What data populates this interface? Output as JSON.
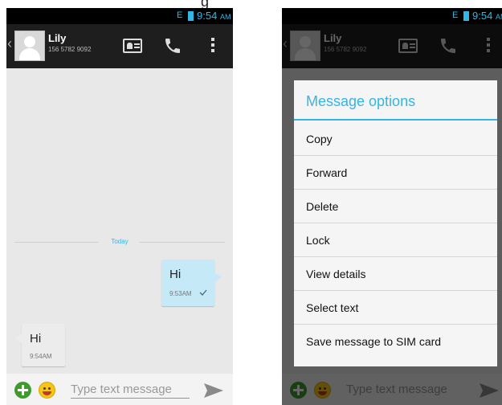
{
  "status": {
    "time": "9:54",
    "ampm": "AM",
    "network": "E"
  },
  "caption": "g",
  "contact": {
    "name": "Lily",
    "number": "156 5782 9092"
  },
  "thread": {
    "divider": "Today",
    "messages": [
      {
        "direction": "outgoing",
        "text": "Hi",
        "time": "9:53AM",
        "delivered": true
      },
      {
        "direction": "incoming",
        "text": "Hi",
        "time": "9:54AM"
      }
    ]
  },
  "composer": {
    "placeholder": "Type text message"
  },
  "dialog": {
    "title": "Message options",
    "options": [
      "Copy",
      "Forward",
      "Delete",
      "Lock",
      "View details",
      "Select text",
      "Save message to SIM card"
    ]
  },
  "colors": {
    "accent": "#33b5e5",
    "action_bar": "#1e1e1e",
    "outgoing_bubble": "#c6e9f7",
    "incoming_bubble": "#ececec",
    "add_button": "#3f9b2e"
  },
  "icons": [
    "back-chevron-icon",
    "contact-avatar-icon",
    "contact-card-icon",
    "phone-call-icon",
    "overflow-menu-icon",
    "delivered-check-icon",
    "add-attachment-icon",
    "emoji-icon",
    "send-icon"
  ]
}
